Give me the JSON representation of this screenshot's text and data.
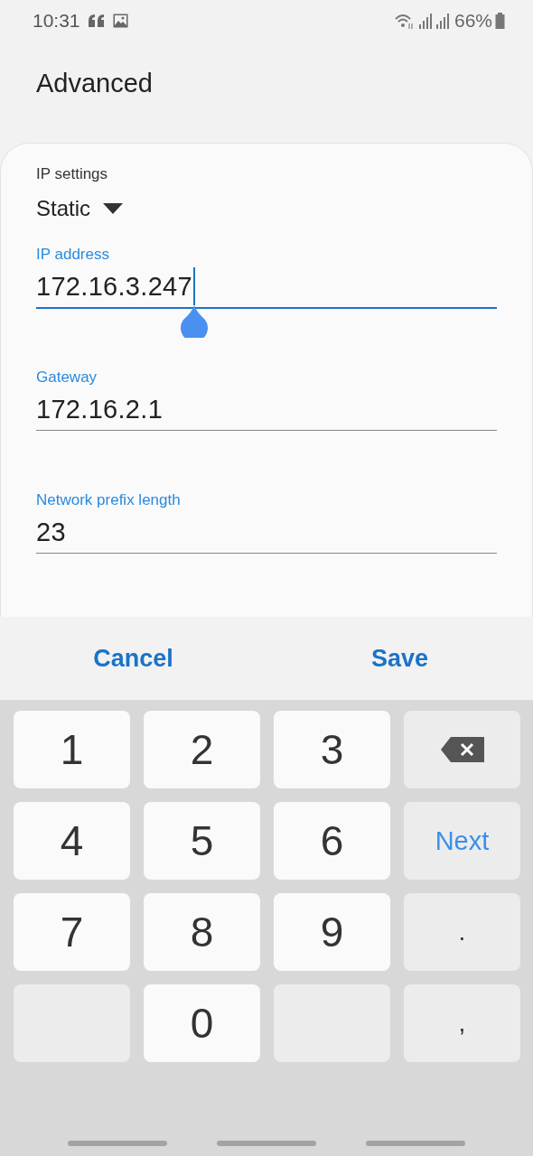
{
  "status_bar": {
    "time": "10:31",
    "battery": "66%"
  },
  "title": "Advanced",
  "ip_settings": {
    "label": "IP settings",
    "value": "Static"
  },
  "fields": [
    {
      "label": "IP address",
      "value": "172.16.3.247",
      "focused": true
    },
    {
      "label": "Gateway",
      "value": "172.16.2.1",
      "focused": false
    },
    {
      "label": "Network prefix length",
      "value": "23",
      "focused": false
    }
  ],
  "buttons": [
    "Cancel",
    "Save"
  ],
  "keyboard": {
    "keys": [
      {
        "kind": "digit",
        "label": "1"
      },
      {
        "kind": "digit",
        "label": "2"
      },
      {
        "kind": "digit",
        "label": "3"
      },
      {
        "kind": "backspace"
      },
      {
        "kind": "digit",
        "label": "4"
      },
      {
        "kind": "digit",
        "label": "5"
      },
      {
        "kind": "digit",
        "label": "6"
      },
      {
        "kind": "action",
        "label": "Next"
      },
      {
        "kind": "digit",
        "label": "7"
      },
      {
        "kind": "digit",
        "label": "8"
      },
      {
        "kind": "digit",
        "label": "9"
      },
      {
        "kind": "symbol",
        "label": "."
      },
      {
        "kind": "blank"
      },
      {
        "kind": "digit",
        "label": "0"
      },
      {
        "kind": "blank"
      },
      {
        "kind": "symbol",
        "label": ","
      }
    ]
  }
}
